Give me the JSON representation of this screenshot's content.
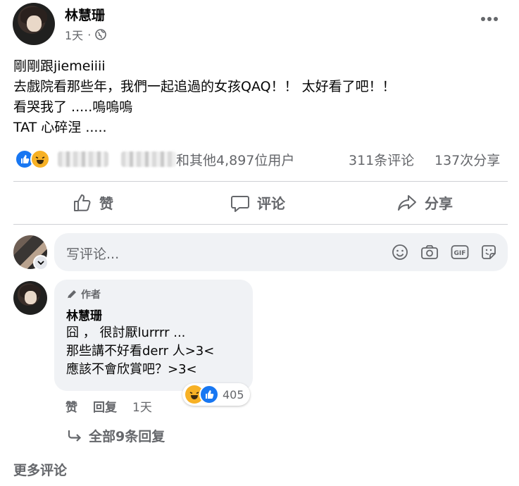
{
  "post": {
    "author": "林慧珊",
    "time": "1天",
    "lines": [
      "剛剛跟jiemeiiii",
      "去戲院看那些年，我們一起追過的女孩QAQ！！ 太好看了吧！！",
      "看哭我了 .....嗚嗚嗚",
      "TAT 心碎涅 ....."
    ],
    "reactions_text": "和其他4,897位用户",
    "comments_count": "311条评论",
    "shares_count": "137次分享"
  },
  "actions": {
    "like": "赞",
    "comment": "评论",
    "share": "分享"
  },
  "composer": {
    "placeholder": "写评论..."
  },
  "comment": {
    "badge": "作者",
    "author": "林慧珊",
    "lines": [
      "囧 ， 很討厭lurrrr ...",
      "那些講不好看derr 人>3<",
      "應該不會欣賞吧？>3<"
    ],
    "reaction_count": "405",
    "like": "赞",
    "reply": "回复",
    "time": "1天",
    "view_replies": "全部9条回复"
  },
  "more_comments": "更多评论",
  "colors": {
    "like_blue": "#1877f2",
    "haha_yellow": "#f7b125",
    "secondary_text": "#65676b"
  },
  "icons": [
    "globe-icon",
    "more-icon",
    "like-icon",
    "comment-icon",
    "share-icon",
    "emoji-icon",
    "camera-icon",
    "gif-icon",
    "sticker-icon",
    "pencil-icon",
    "reply-arrow-icon",
    "chevron-down-icon"
  ]
}
